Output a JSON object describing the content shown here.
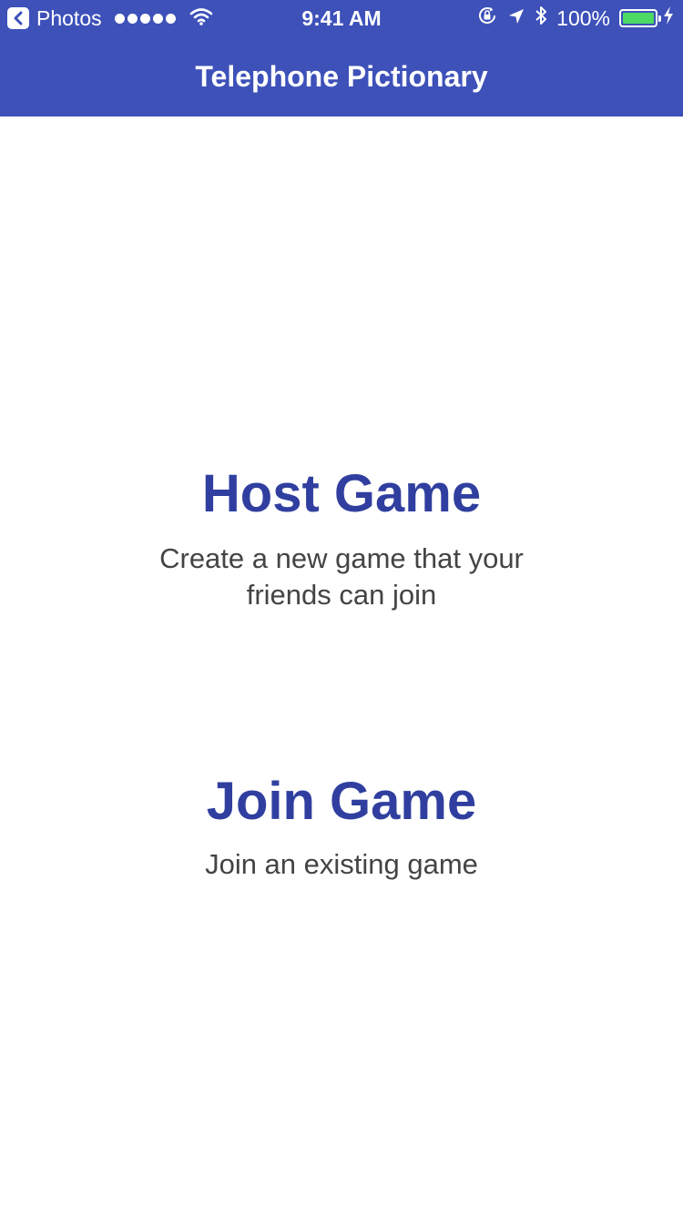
{
  "status_bar": {
    "back_app": "Photos",
    "time": "9:41 AM",
    "battery": "100%",
    "signal_bars": 5,
    "battery_level": 1.0,
    "battery_color": "#4cd964"
  },
  "nav": {
    "title": "Telephone Pictionary",
    "color": "#3d51b9"
  },
  "options": {
    "host": {
      "title": "Host Game",
      "description": "Create a new game that your friends can join"
    },
    "join": {
      "title": "Join Game",
      "description": "Join an existing game"
    }
  },
  "colors": {
    "accent": "#303f9f",
    "text": "#444444"
  }
}
